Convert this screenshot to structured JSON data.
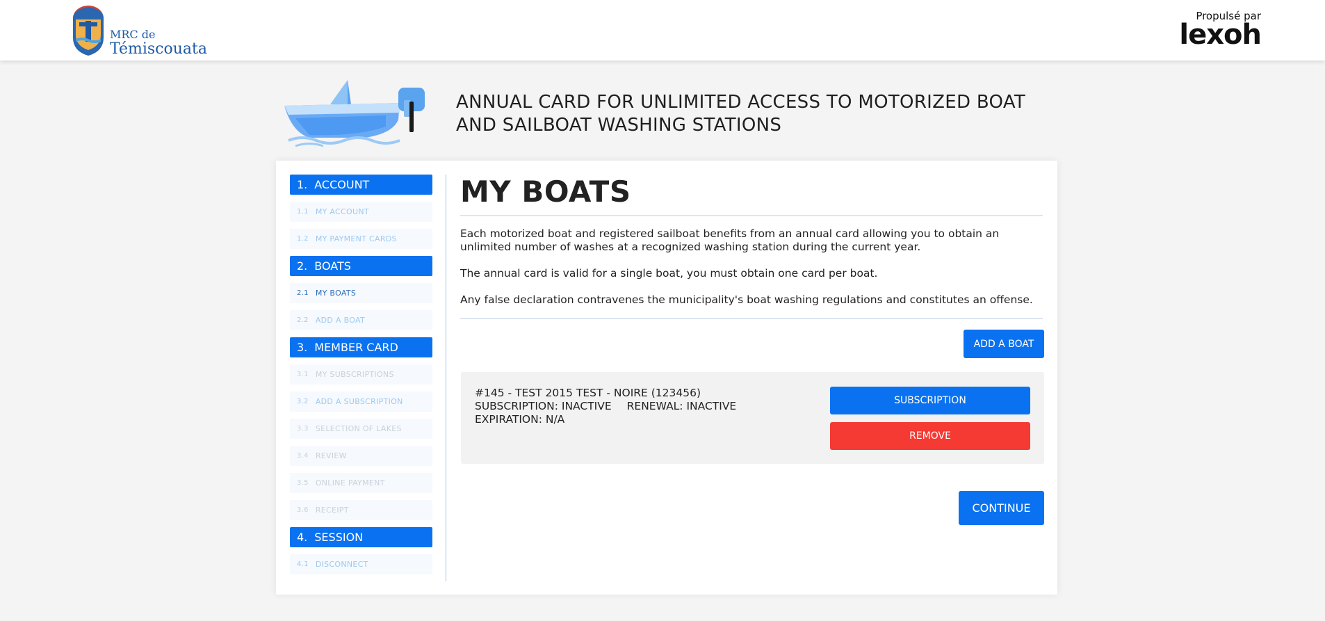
{
  "header": {
    "logo_line1": "MRC de",
    "logo_line2": "Témiscouata",
    "powered_by": "Propulsé par",
    "brand": "lexoh"
  },
  "banner": {
    "title": "ANNUAL CARD FOR UNLIMITED ACCESS TO MOTORIZED BOAT AND SAILBOAT WASHING STATIONS"
  },
  "sidebar": {
    "sections": [
      {
        "num": "1.",
        "label": "ACCOUNT",
        "items": [
          {
            "num": "1.1",
            "label": "MY ACCOUNT"
          },
          {
            "num": "1.2",
            "label": "MY PAYMENT CARDS"
          }
        ]
      },
      {
        "num": "2.",
        "label": "BOATS",
        "items": [
          {
            "num": "2.1",
            "label": "MY BOATS"
          },
          {
            "num": "2.2",
            "label": "ADD A BOAT"
          }
        ]
      },
      {
        "num": "3.",
        "label": "MEMBER CARD",
        "items": [
          {
            "num": "3.1",
            "label": "MY SUBSCRIPTIONS"
          },
          {
            "num": "3.2",
            "label": "ADD A SUBSCRIPTION"
          },
          {
            "num": "3.3",
            "label": "SELECTION OF LAKES"
          },
          {
            "num": "3.4",
            "label": "REVIEW"
          },
          {
            "num": "3.5",
            "label": "ONLINE PAYMENT"
          },
          {
            "num": "3.6",
            "label": "RECEIPT"
          }
        ]
      },
      {
        "num": "4.",
        "label": "SESSION",
        "items": [
          {
            "num": "4.1",
            "label": "DISCONNECT"
          }
        ]
      }
    ]
  },
  "main": {
    "title": "MY BOATS",
    "paragraphs": [
      "Each motorized boat and registered sailboat benefits from an annual card allowing you to obtain an unlimited number of washes at a recognized washing station during the current year.",
      "The annual card is valid for a single boat, you must obtain one card per boat.",
      "Any false declaration contravenes the municipality's boat washing regulations and constitutes an offense."
    ],
    "add_boat_label": "ADD A BOAT",
    "boat": {
      "name_line": "#145 - TEST 2015 TEST - NOIRE (123456)",
      "subscription": "SUBSCRIPTION: INACTIVE",
      "renewal": "RENEWAL: INACTIVE",
      "expiration": "EXPIRATION: N/A",
      "subscription_button": "SUBSCRIPTION",
      "remove_button": "REMOVE"
    },
    "continue_label": "CONTINUE"
  },
  "colors": {
    "primary": "#0a72f0",
    "danger": "#f43a33",
    "logo_blue": "#1e5aa6"
  }
}
